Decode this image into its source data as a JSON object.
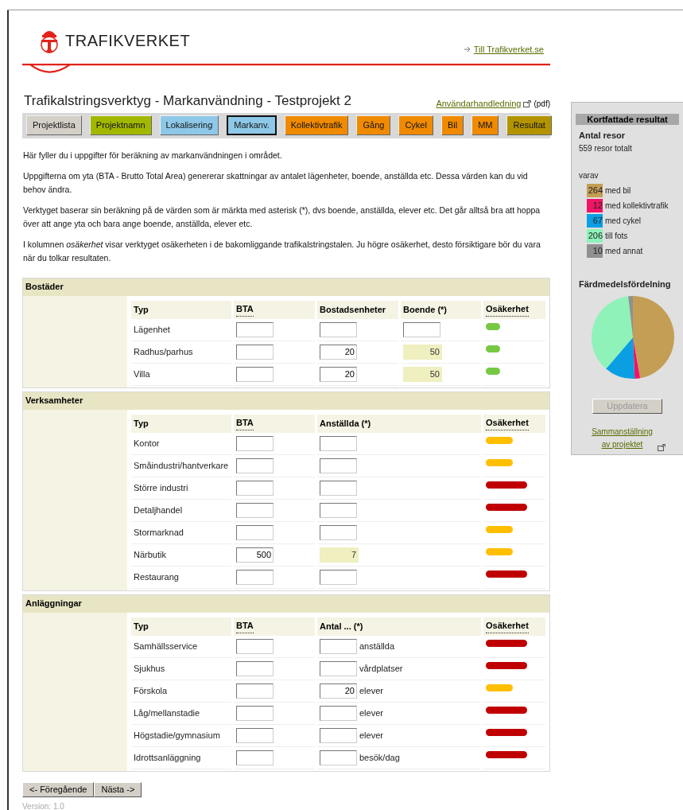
{
  "header": {
    "logo_text": "TRAFIKVERKET",
    "site_link": "Till Trafikverket.se"
  },
  "page_title": "Trafikalstringsverktyg - Markanvändning - Testprojekt 2",
  "manual_link": {
    "label": "Användarhandledning",
    "suffix": "(pdf)"
  },
  "tabs": [
    {
      "label": "Projektlista",
      "color": "#d4d0c8",
      "selected": false
    },
    {
      "label": "Projektnamn",
      "color": "#a2b800",
      "selected": false
    },
    {
      "label": "Lokalisering",
      "color": "#8ec8e8",
      "selected": false
    },
    {
      "label": "Markanv.",
      "color": "#8ec8e8",
      "selected": true
    },
    {
      "label": "Kollektivtrafik",
      "color": "#f08a00",
      "selected": false
    },
    {
      "label": "Gång",
      "color": "#f08a00",
      "selected": false
    },
    {
      "label": "Cykel",
      "color": "#f08a00",
      "selected": false
    },
    {
      "label": "Bil",
      "color": "#f08a00",
      "selected": false
    },
    {
      "label": "MM",
      "color": "#f08a00",
      "selected": false
    },
    {
      "label": "Resultat",
      "color": "#b39400",
      "selected": false
    }
  ],
  "intro": [
    "Här fyller du i uppgifter för beräkning av markanvändningen i området.",
    "Uppgifterna om yta (BTA - Brutto Total Area) genererar skattningar av antalet lägenheter, boende, anställda etc. Dessa värden kan du vid behov ändra.",
    "Verktyget baserar sin beräkning på de värden som är märkta med asterisk (*), dvs boende, anställda, elever etc. Det går alltså bra att hoppa över att ange yta och bara ange boende, anställda, elever etc.",
    "I kolumnen *osäkerhet* visar verktyget osäkerheten i de bakomliggande trafikalstringstalen. Ju högre osäkerhet, desto försiktigare bör du vara när du tolkar resultaten."
  ],
  "sections": [
    {
      "title": "Bostäder",
      "columns": [
        {
          "label": "Typ",
          "tooltip": false
        },
        {
          "label": "BTA",
          "tooltip": true
        },
        {
          "label": "Bostadsenheter",
          "tooltip": false
        },
        {
          "label": "Boende (*)",
          "tooltip": false
        },
        {
          "label": "Osäkerhet",
          "tooltip": true
        }
      ],
      "rows": [
        {
          "type": "Lägenhet",
          "fields": [
            {
              "kind": "input"
            },
            {
              "kind": "input"
            },
            {
              "kind": "input"
            }
          ],
          "kind": "low"
        },
        {
          "type": "Radhus/parhus",
          "fields": [
            {
              "kind": "input"
            },
            {
              "kind": "input",
              "value": "20"
            },
            {
              "kind": "computed",
              "value": "50"
            }
          ],
          "kind": "low"
        },
        {
          "type": "Villa",
          "fields": [
            {
              "kind": "input"
            },
            {
              "kind": "input",
              "value": "20"
            },
            {
              "kind": "computed",
              "value": "50"
            }
          ],
          "kind": "low"
        }
      ]
    },
    {
      "title": "Verksamheter",
      "columns": [
        {
          "label": "Typ",
          "tooltip": false
        },
        {
          "label": "BTA",
          "tooltip": true
        },
        {
          "label": "Anställda (*)",
          "tooltip": false
        },
        {
          "label": "Osäkerhet",
          "tooltip": true
        }
      ],
      "rows": [
        {
          "type": "Kontor",
          "fields": [
            {
              "kind": "input"
            },
            {
              "kind": "input"
            }
          ],
          "kind": "medium"
        },
        {
          "type": "Småindustri/hantverkare",
          "fields": [
            {
              "kind": "input"
            },
            {
              "kind": "input"
            }
          ],
          "kind": "medium"
        },
        {
          "type": "Större industri",
          "fields": [
            {
              "kind": "input"
            },
            {
              "kind": "input"
            }
          ],
          "kind": "high"
        },
        {
          "type": "Detaljhandel",
          "fields": [
            {
              "kind": "input"
            },
            {
              "kind": "input"
            }
          ],
          "kind": "high"
        },
        {
          "type": "Stormarknad",
          "fields": [
            {
              "kind": "input"
            },
            {
              "kind": "input"
            }
          ],
          "kind": "medium"
        },
        {
          "type": "Närbutik",
          "fields": [
            {
              "kind": "input",
              "value": "500"
            },
            {
              "kind": "computed",
              "value": "7"
            }
          ],
          "kind": "medium"
        },
        {
          "type": "Restaurang",
          "fields": [
            {
              "kind": "input"
            },
            {
              "kind": "input"
            }
          ],
          "kind": "high"
        }
      ]
    },
    {
      "title": "Anläggningar",
      "columns": [
        {
          "label": "Typ",
          "tooltip": false
        },
        {
          "label": "BTA",
          "tooltip": true
        },
        {
          "label": "Antal ... (*)",
          "tooltip": false
        },
        {
          "label": "Osäkerhet",
          "tooltip": true
        }
      ],
      "rows": [
        {
          "type": "Samhällsservice",
          "fields": [
            {
              "kind": "input"
            },
            {
              "kind": "input",
              "unit": "anställda"
            }
          ],
          "kind": "high"
        },
        {
          "type": "Sjukhus",
          "fields": [
            {
              "kind": "input"
            },
            {
              "kind": "input",
              "unit": "vårdplatser"
            }
          ],
          "kind": "high"
        },
        {
          "type": "Förskola",
          "fields": [
            {
              "kind": "input"
            },
            {
              "kind": "input",
              "value": "20",
              "unit": "elever"
            }
          ],
          "kind": "medium"
        },
        {
          "type": "Låg/mellanstadie",
          "fields": [
            {
              "kind": "input"
            },
            {
              "kind": "input",
              "unit": "elever"
            }
          ],
          "kind": "high"
        },
        {
          "type": "Högstadie/gymnasium",
          "fields": [
            {
              "kind": "input"
            },
            {
              "kind": "input",
              "unit": "elever"
            }
          ],
          "kind": "high"
        },
        {
          "type": "Idrottsanläggning",
          "fields": [
            {
              "kind": "input"
            },
            {
              "kind": "input",
              "unit": "besök/dag"
            }
          ],
          "kind": "high"
        }
      ]
    }
  ],
  "nav_buttons": [
    "<- Föregående",
    "Nästa ->"
  ],
  "version": "Version: 1.0",
  "sidebar": {
    "title": "Kortfattade resultat",
    "subtitle": "Antal resor",
    "total": "559 resor totalt",
    "breakdown_label": "varav",
    "legend": [
      {
        "count": "264",
        "color": "#c49e55"
      },
      {
        "count": "12",
        "color": "#f01464"
      },
      {
        "count": "67",
        "color": "#0a9fe3"
      },
      {
        "count": "206",
        "color": "#8ef2b9"
      },
      {
        "count": "10",
        "color": "#909090"
      }
    ],
    "chart_data": {
      "type": "pie",
      "title": "Färdmedelsfördelning",
      "categories": [
        "med bil",
        "med kollektivtrafik",
        "med cykel",
        "till fots",
        "med annat"
      ],
      "values": [
        47.2,
        2.1,
        12.0,
        36.9,
        1.8
      ]
    },
    "update_button": {
      "label": "Uppdatera",
      "disabled": true
    },
    "summary_link": "Sammanställning av projektet"
  }
}
